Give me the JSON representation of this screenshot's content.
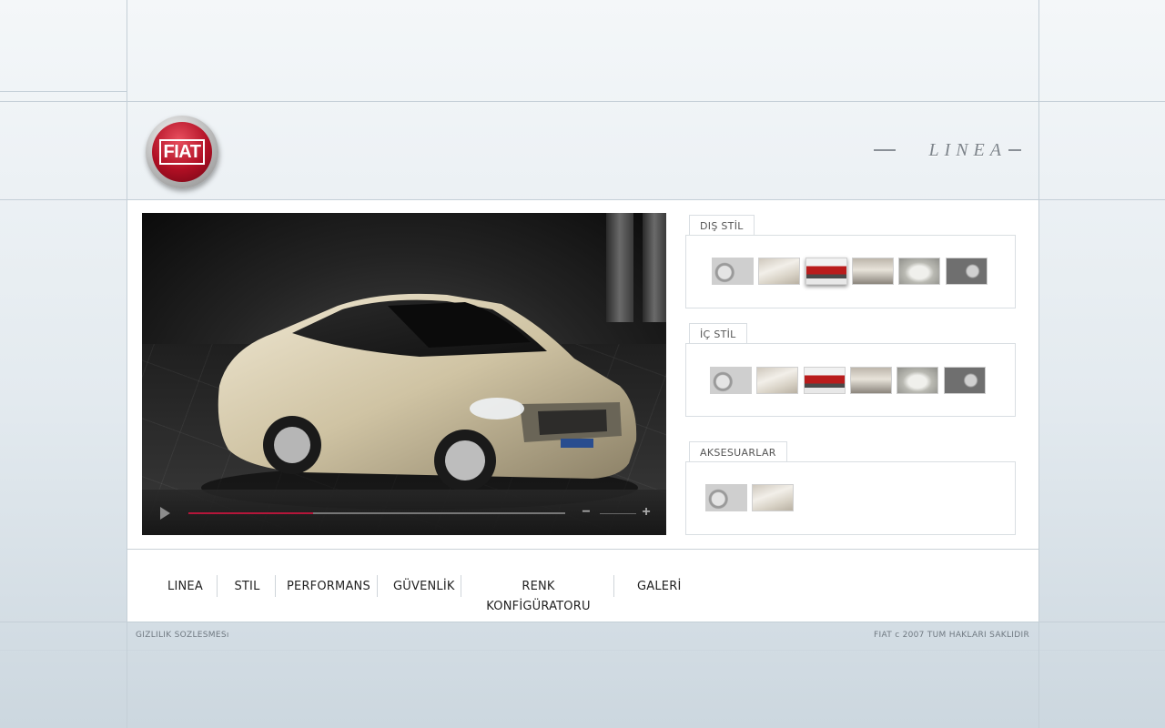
{
  "brand": {
    "logo_text": "FIAT",
    "model_logo_text": "LINEA",
    "brand_color": "#b10f24"
  },
  "video_player": {
    "progress_fraction": 0.33,
    "accent_color": "#b5163a",
    "play_icon": "play-icon",
    "volume_down_symbol": "−",
    "volume_up_symbol": "+"
  },
  "galleries": [
    {
      "title": "DIŞ STİL",
      "thumbnails": [
        "steering-wheel",
        "leather-seat",
        "red-car",
        "interior",
        "silver-car",
        "dashboard"
      ],
      "selected_index": 2
    },
    {
      "title": "İÇ STİL",
      "thumbnails": [
        "steering-wheel",
        "leather-seat",
        "red-car",
        "interior",
        "silver-car",
        "dashboard"
      ]
    },
    {
      "title": "AKSESUARLAR",
      "thumbnails": [
        "steering-wheel",
        "leather-seat"
      ]
    }
  ],
  "nav": {
    "items": [
      "LINEA",
      "STIL",
      "PERFORMANS",
      "GÜVENLİK",
      "RENK KONFİGÜRATORU",
      "GALERİ"
    ]
  },
  "footer": {
    "privacy_link": "GIZLILIK SOZLESMESı",
    "copyright": "FIAT c 2007 TUM HAKLARI SAKLIDIR"
  }
}
